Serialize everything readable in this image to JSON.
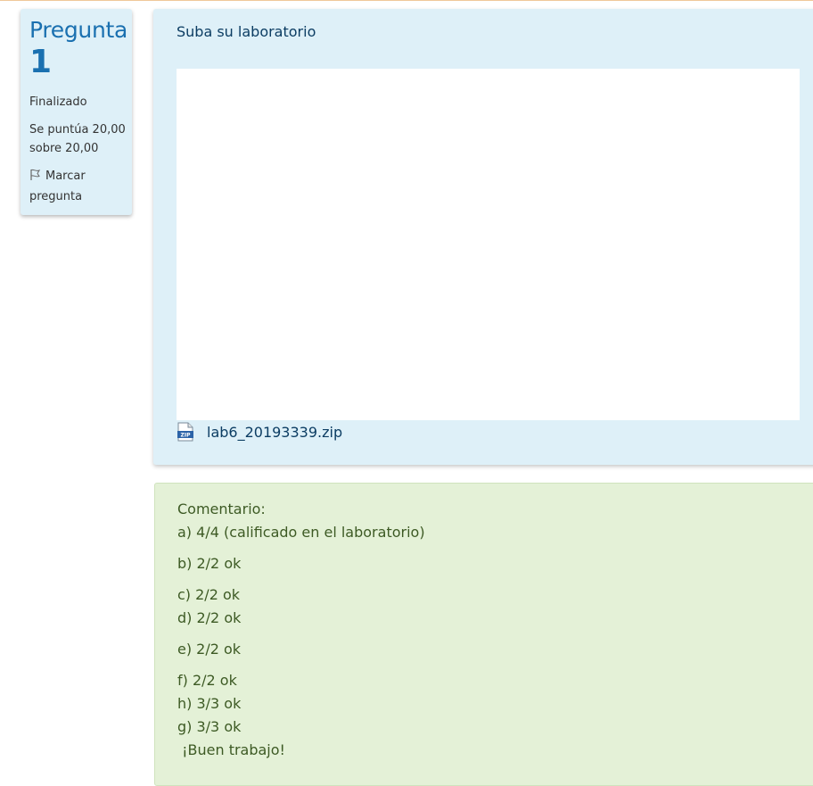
{
  "info": {
    "question_label": "Pregunta",
    "question_number": "1",
    "state": "Finalizado",
    "grade": "Se puntúa 20,00 sobre 20,00",
    "flag_label": "Marcar pregunta"
  },
  "question": {
    "text": "Suba su laboratorio",
    "attachment": {
      "icon": "zip-file-icon",
      "name": "lab6_20193339.zip"
    }
  },
  "comment": {
    "heading": "Comentario:",
    "lines": [
      "a) 4/4 (calificado en el laboratorio)",
      "b) 2/2 ok",
      "c) 2/2 ok",
      "d) 2/2 ok",
      "e) 2/2 ok",
      "f) 2/2 ok",
      "h) 3/3 ok",
      "g) 3/3 ok",
      " ¡Buen trabajo!"
    ]
  },
  "colors": {
    "info_background": "#def0f8",
    "accent_blue": "#1a70b0",
    "comment_background": "#e4f1d7",
    "comment_text": "#3d5a24"
  }
}
